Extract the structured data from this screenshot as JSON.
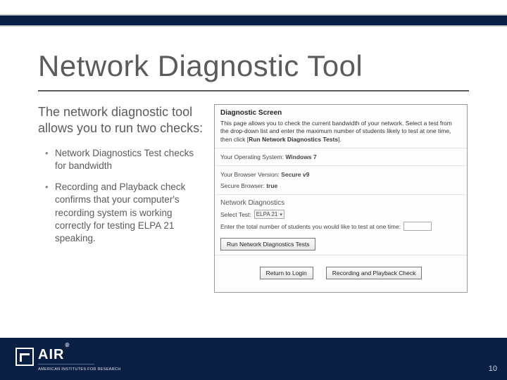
{
  "title": "Network Diagnostic Tool",
  "intro": "The network diagnostic tool allows you to run two checks:",
  "bullets": [
    "Network Diagnostics Test checks for bandwidth",
    "Recording and Playback check confirms that your computer's recording system is working correctly for testing ELPA 21 speaking."
  ],
  "panel": {
    "screen_title": "Diagnostic Screen",
    "screen_desc_a": "This page allows you to check the current bandwidth of your network. Select a test from the drop-down list and enter the maximum number of students likely to test at one time, then click [",
    "screen_desc_b": "Run Network Diagnostics Tests",
    "screen_desc_c": "].",
    "os_label": "Your Operating System:",
    "os_value": "Windows 7",
    "browser_label": "Your Browser Version:",
    "browser_value": "Secure v9",
    "secure_label": "Secure Browser:",
    "secure_value": "true",
    "nd_title": "Network Diagnostics",
    "select_label": "Select Test:",
    "select_value": "ELPA 21",
    "students_label": "Enter the total number of students you would like to test at one time:",
    "run_btn": "Run Network Diagnostics Tests",
    "return_btn": "Return to Login",
    "rec_btn": "Recording and Playback Check"
  },
  "logo": {
    "air": "AIR",
    "reg": "®",
    "sub": "AMERICAN INSTITUTES FOR RESEARCH"
  },
  "page_number": "10"
}
